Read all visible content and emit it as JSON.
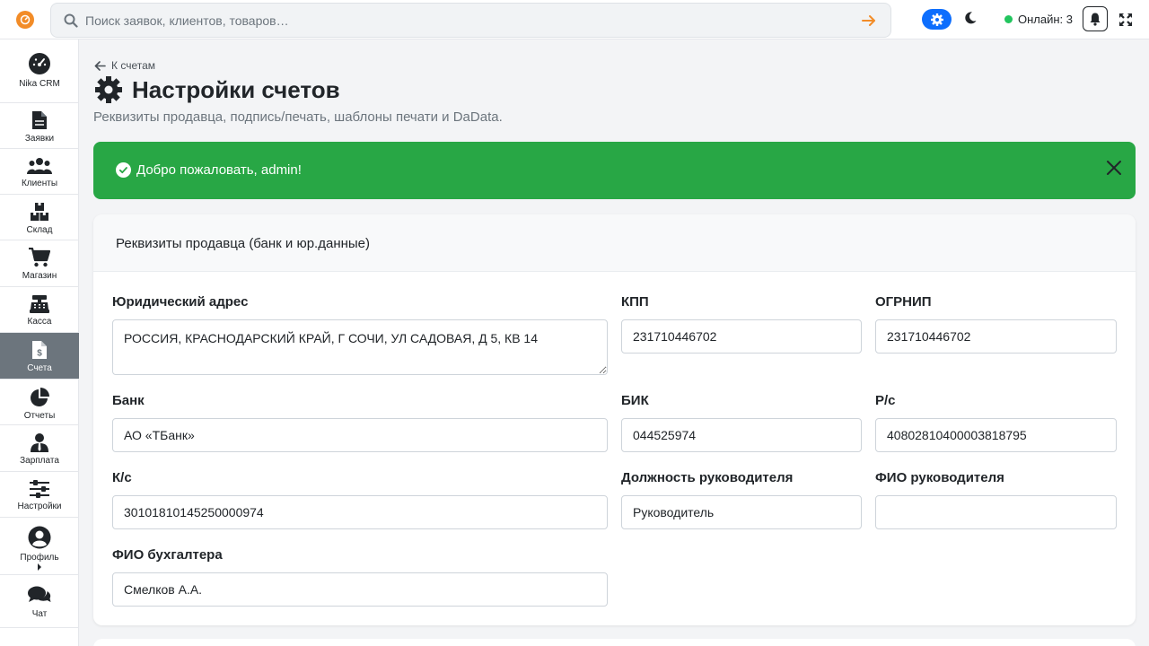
{
  "topbar": {
    "search_placeholder": "Поиск заявок, клиентов, товаров…",
    "online_text": "Онлайн: 3"
  },
  "sidebar": {
    "items": [
      {
        "label": "Nika CRM",
        "icon": "dashboard-icon"
      },
      {
        "label": "Заявки",
        "icon": "document-icon"
      },
      {
        "label": "Клиенты",
        "icon": "users-icon"
      },
      {
        "label": "Склад",
        "icon": "boxes-icon"
      },
      {
        "label": "Магазин",
        "icon": "cart-icon"
      },
      {
        "label": "Касса",
        "icon": "cash-register-icon"
      },
      {
        "label": "Счета",
        "icon": "invoice-icon",
        "active": true
      },
      {
        "label": "Отчеты",
        "icon": "pie-chart-icon"
      },
      {
        "label": "Зарплата",
        "icon": "user-tie-icon"
      },
      {
        "label": "Настройки",
        "icon": "sliders-icon"
      },
      {
        "label": "Профиль",
        "icon": "user-circle-icon"
      },
      {
        "label": "Чат",
        "icon": "chat-icon"
      }
    ]
  },
  "page": {
    "back_label": "К счетам",
    "title": "Настройки счетов",
    "subtitle": "Реквизиты продавца, подпись/печать, шаблоны печати и DaData."
  },
  "alert": {
    "message": "Добро пожаловать, admin!"
  },
  "seller": {
    "heading": "Реквизиты продавца (банк и юр.данные)",
    "fields": {
      "legal_address": {
        "label": "Юридический адрес",
        "value": "РОССИЯ, КРАСНОДАРСКИЙ КРАЙ, Г СОЧИ, УЛ САДОВАЯ, Д 5, КВ 14"
      },
      "kpp": {
        "label": "КПП",
        "value": "231710446702"
      },
      "ogrnip": {
        "label": "ОГРНИП",
        "value": "231710446702"
      },
      "bank": {
        "label": "Банк",
        "value": "АО «ТБанк»"
      },
      "bik": {
        "label": "БИК",
        "value": "044525974"
      },
      "rs": {
        "label": "Р/с",
        "value": "40802810400003818795"
      },
      "ks": {
        "label": "К/с",
        "value": "30101810145250000974"
      },
      "director_position": {
        "label": "Должность руководителя",
        "value": "Руководитель"
      },
      "director_name": {
        "label": "ФИО руководителя",
        "value": ""
      },
      "accountant_name": {
        "label": "ФИО бухгалтера",
        "value": "Смелков А.А."
      }
    }
  },
  "colors": {
    "success": "#28a745",
    "primary": "#0d6efd",
    "brand": "#f28c28",
    "sidebar_active": "#6c757d"
  }
}
